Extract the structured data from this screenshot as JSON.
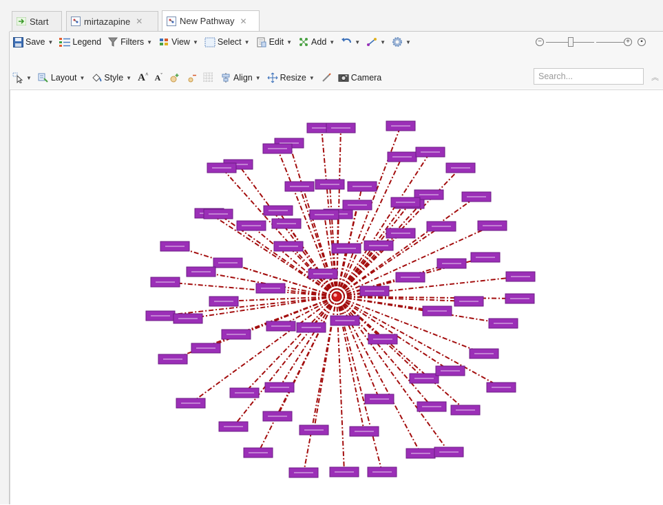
{
  "tabs": [
    {
      "label": "Start",
      "active": false,
      "closable": false
    },
    {
      "label": "mirtazapine",
      "active": false,
      "closable": true
    },
    {
      "label": "New Pathway",
      "active": true,
      "closable": true
    }
  ],
  "toolbar_row1": {
    "save": "Save",
    "legend": "Legend",
    "filters": "Filters",
    "view": "View",
    "select": "Select",
    "edit": "Edit",
    "add": "Add"
  },
  "toolbar_row2": {
    "layout": "Layout",
    "style": "Style",
    "align": "Align",
    "resize": "Resize",
    "camera": "Camera"
  },
  "search": {
    "placeholder": "Search..."
  },
  "zoom": {
    "level_fraction": 0.47
  },
  "colors": {
    "node_fill": "#9b2fb7",
    "edge": "#a30d0d",
    "hub": "#d11a1a"
  }
}
